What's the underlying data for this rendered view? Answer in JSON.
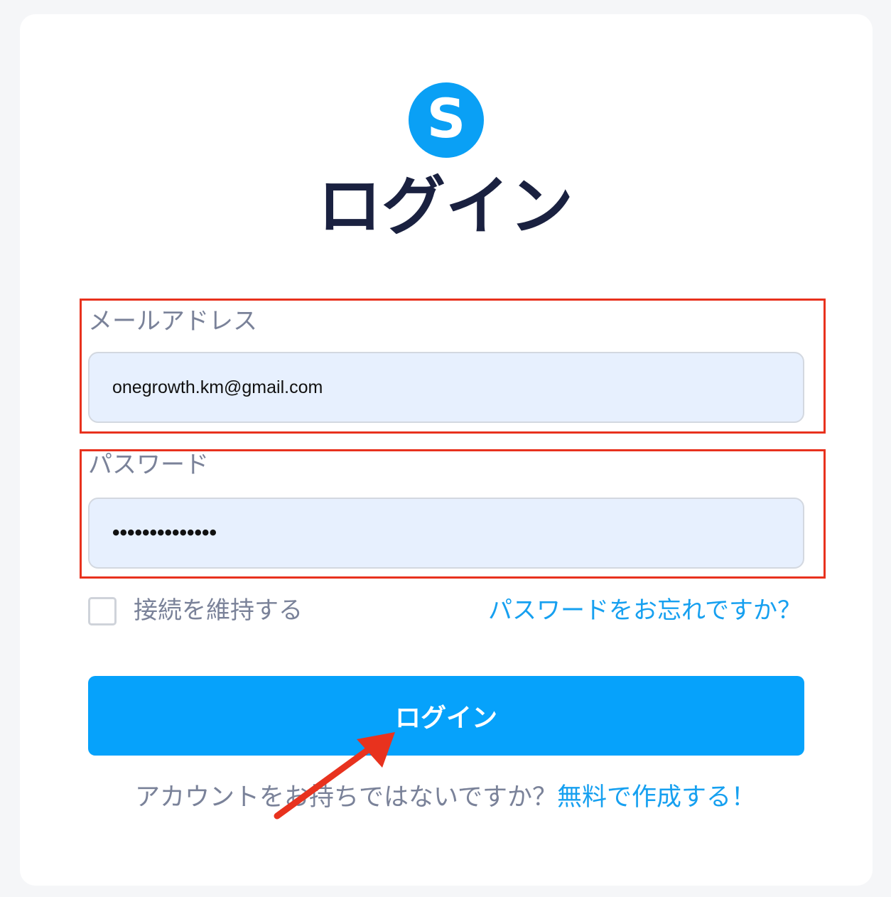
{
  "logo": {
    "letter": "S",
    "color": "#0aa0f5"
  },
  "page_title": "ログイン",
  "email": {
    "label": "メールアドレス",
    "value": "onegrowth.km@gmail.com"
  },
  "password": {
    "label": "パスワード",
    "value": "••••••••••••••"
  },
  "remember": {
    "label": "接続を維持する",
    "checked": false
  },
  "forgot_link": "パスワードをお忘れですか？",
  "login_button": "ログイン",
  "signup": {
    "question": "アカウントをお持ちではないですか？",
    "link": "無料で作成する！"
  },
  "colors": {
    "accent": "#06a2fb",
    "link": "#16a0f0",
    "annotation": "#e8321e"
  }
}
